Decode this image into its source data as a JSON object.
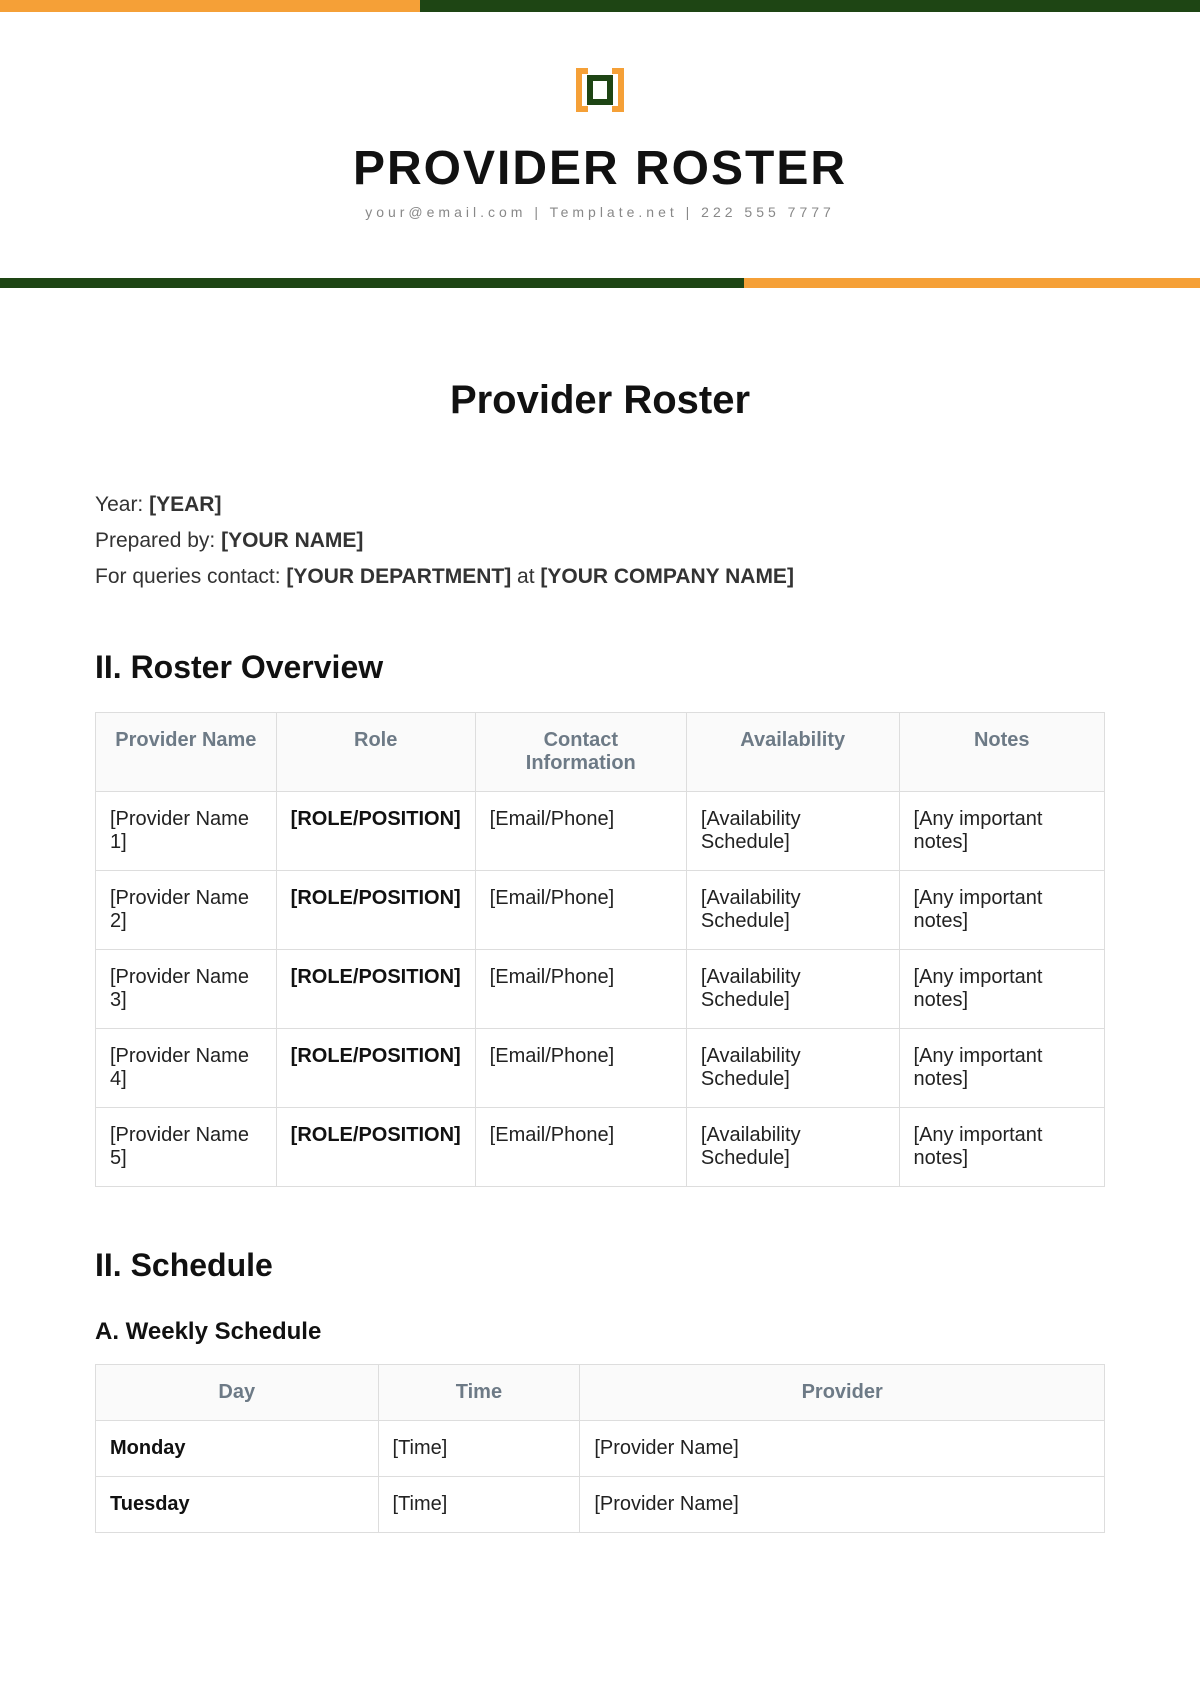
{
  "colors": {
    "orange": "#f5a037",
    "green": "#1e4514"
  },
  "header": {
    "title": "PROVIDER ROSTER",
    "subline": "your@email.com | Template.net | 222 555 7777"
  },
  "page_title": "Provider Roster",
  "meta": {
    "year_label": "Year: ",
    "year_value": "[YEAR]",
    "prepared_label": "Prepared by: ",
    "prepared_value": "[YOUR NAME]",
    "contact_prefix": "For queries contact: ",
    "contact_dept": "[YOUR DEPARTMENT]",
    "contact_mid": " at ",
    "contact_company": "[YOUR COMPANY NAME]"
  },
  "overview": {
    "heading": "II. Roster Overview",
    "headers": [
      "Provider Name",
      "Role",
      "Contact Information",
      "Availability",
      "Notes"
    ],
    "rows": [
      {
        "name": "[Provider Name 1]",
        "role": "[ROLE/POSITION]",
        "contact": "[Email/Phone]",
        "avail": "[Availability Schedule]",
        "notes": "[Any important notes]"
      },
      {
        "name": "[Provider Name 2]",
        "role": "[ROLE/POSITION]",
        "contact": "[Email/Phone]",
        "avail": "[Availability Schedule]",
        "notes": "[Any important notes]"
      },
      {
        "name": "[Provider Name 3]",
        "role": "[ROLE/POSITION]",
        "contact": "[Email/Phone]",
        "avail": "[Availability Schedule]",
        "notes": "[Any important notes]"
      },
      {
        "name": "[Provider Name 4]",
        "role": "[ROLE/POSITION]",
        "contact": "[Email/Phone]",
        "avail": "[Availability Schedule]",
        "notes": "[Any important notes]"
      },
      {
        "name": "[Provider Name 5]",
        "role": "[ROLE/POSITION]",
        "contact": "[Email/Phone]",
        "avail": "[Availability Schedule]",
        "notes": "[Any important notes]"
      }
    ]
  },
  "schedule": {
    "heading": "II. Schedule",
    "sub_heading": "A. Weekly Schedule",
    "headers": [
      "Day",
      "Time",
      "Provider"
    ],
    "rows": [
      {
        "day": "Monday",
        "time": "[Time]",
        "provider": "[Provider Name]"
      },
      {
        "day": "Tuesday",
        "time": "[Time]",
        "provider": "[Provider Name]"
      }
    ]
  }
}
